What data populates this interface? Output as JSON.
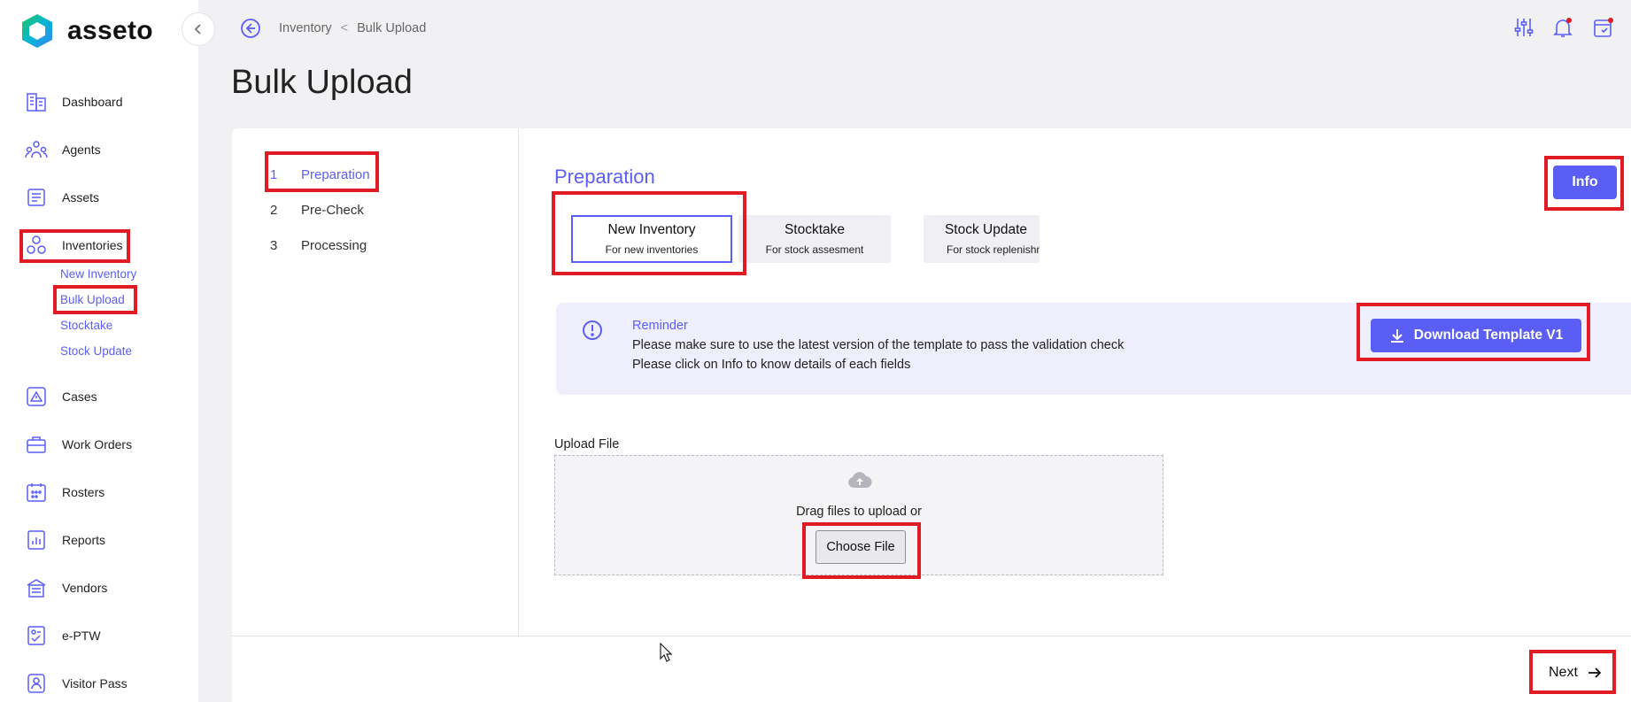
{
  "app": {
    "brand": "asseto"
  },
  "sidebar": {
    "items": [
      {
        "label": "Dashboard",
        "icon": "building-icon"
      },
      {
        "label": "Agents",
        "icon": "agents-icon"
      },
      {
        "label": "Assets",
        "icon": "assets-icon"
      },
      {
        "label": "Inventories",
        "icon": "inventories-icon"
      },
      {
        "label": "Cases",
        "icon": "cases-icon"
      },
      {
        "label": "Work Orders",
        "icon": "toolbox-icon"
      },
      {
        "label": "Rosters",
        "icon": "calendar-icon"
      },
      {
        "label": "Reports",
        "icon": "reports-icon"
      },
      {
        "label": "Vendors",
        "icon": "store-icon"
      },
      {
        "label": "e-PTW",
        "icon": "permit-icon"
      },
      {
        "label": "Visitor Pass",
        "icon": "visitor-icon"
      }
    ],
    "inventory_sub": [
      "New Inventory",
      "Bulk Upload",
      "Stocktake",
      "Stock Update"
    ]
  },
  "breadcrumb": {
    "parent": "Inventory",
    "separator": "<",
    "current": "Bulk Upload"
  },
  "page": {
    "title": "Bulk Upload"
  },
  "steps": [
    {
      "num": "1",
      "label": "Preparation"
    },
    {
      "num": "2",
      "label": "Pre-Check"
    },
    {
      "num": "3",
      "label": "Processing"
    }
  ],
  "preparation": {
    "title": "Preparation",
    "info_label": "Info",
    "types": [
      {
        "title": "New Inventory",
        "sub": "For new inventories"
      },
      {
        "title": "Stocktake",
        "sub": "For stock assesment"
      },
      {
        "title": "Stock Update",
        "sub": "For stock replenishment"
      }
    ],
    "reminder": {
      "title": "Reminder",
      "line1": "Please make sure to use the latest version of the template to pass the validation check",
      "line2": "Please click on Info to know details of each fields"
    },
    "download_label": "Download Template V1",
    "upload_label": "Upload File",
    "drag_text": "Drag files to upload or",
    "choose_label": "Choose File"
  },
  "footer": {
    "next_label": "Next"
  },
  "colors": {
    "accent": "#5b5ef5",
    "highlight": "#e01b24"
  }
}
